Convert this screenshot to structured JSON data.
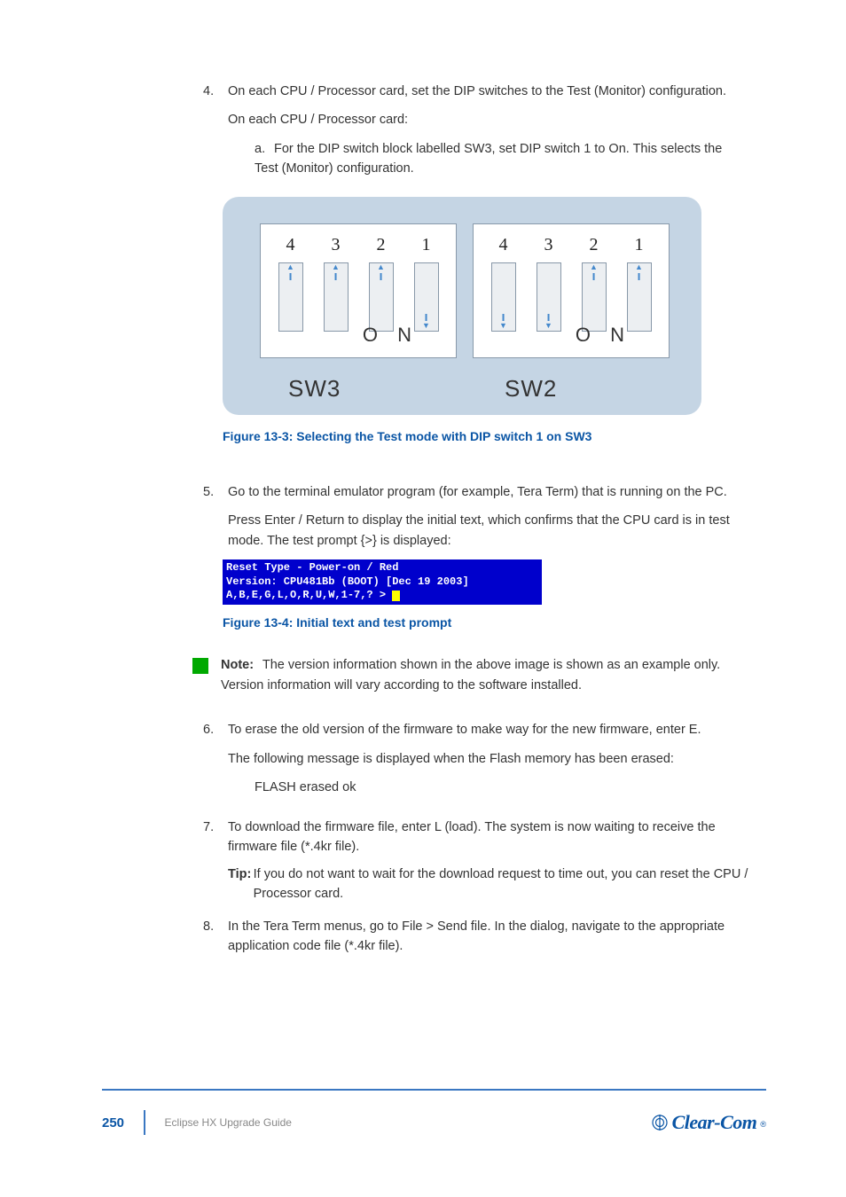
{
  "steps": {
    "s4": {
      "num": "4.",
      "text": "On each CPU / Processor card, set the DIP switches to the Test (Monitor) configuration."
    },
    "s4a": {
      "text": "On each CPU / Processor card:",
      "a_label": "a.",
      "a_text": "For the DIP switch block labelled SW3, set DIP switch 1 to On. This selects the Test (Monitor) configuration."
    },
    "dip": {
      "nums": [
        "4",
        "3",
        "2",
        "1"
      ],
      "on": "O  N",
      "sw3": "SW3",
      "sw2": "SW2",
      "sw3_dirs": [
        "up",
        "up",
        "up",
        "down"
      ],
      "sw2_dirs": [
        "down",
        "down",
        "up",
        "up"
      ]
    },
    "figcap": "Figure 13-3: Selecting the Test mode with DIP switch 1 on SW3",
    "s5": {
      "num": "5.",
      "p1": "Go to the terminal emulator program (for example, Tera Term) that is running on the PC.",
      "p2": "Press Enter / Return to display the initial text, which confirms that the CPU card is in test mode. The test prompt {>} is displayed:"
    },
    "term": {
      "l1": "Reset Type - Power-on / Red",
      "l2": "Version: CPU481Bb (BOOT) [Dec 19 2003]",
      "l3": "A,B,E,G,L,O,R,U,W,1-7,? > "
    },
    "figcap2": "Figure 13-4: Initial text and test prompt",
    "note": {
      "label": "Note:",
      "text": "The version information shown in the above image is shown as an example only. Version information will vary according to the software installed."
    },
    "s6": {
      "num": "6.",
      "p1": "To erase the old version of the firmware to make way for the new firmware, enter E.",
      "p2": "The following message is displayed when the Flash memory has been erased:"
    },
    "erase_msg": "FLASH erased ok",
    "s7": {
      "num": "7.",
      "text": "To download the firmware file, enter L (load). The system is now waiting to receive the firmware file (*.4kr file)."
    },
    "tip": {
      "label": "Tip:",
      "text": "If you do not want to wait for the download request to time out, you can reset the CPU / Processor card."
    },
    "s8": {
      "num": "8.",
      "text": "In the Tera Term menus, go to File > Send file. In the dialog, navigate to the appropriate application code file (*.4kr file)."
    }
  },
  "footer": {
    "page": "250",
    "title": "Eclipse HX Upgrade Guide",
    "logo": "Clear-Com"
  }
}
